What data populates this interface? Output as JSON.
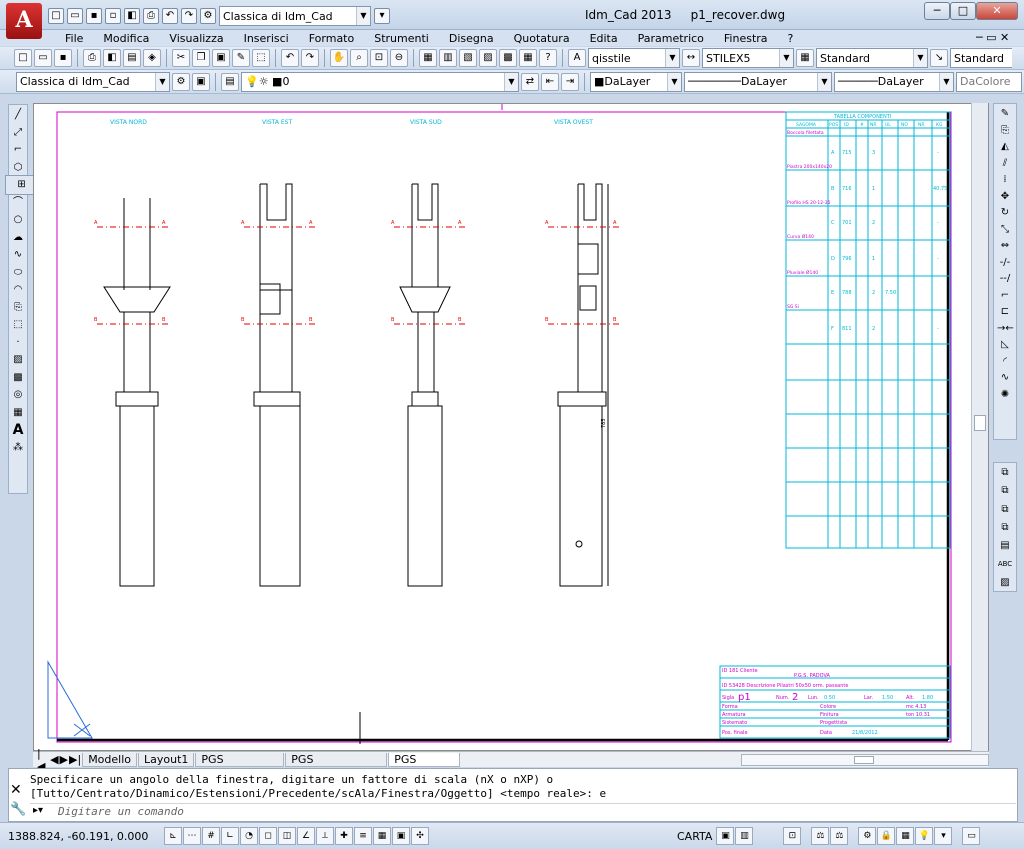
{
  "app": {
    "name": "Idm_Cad 2013",
    "file": "p1_recover.dwg",
    "logo_letter": "A"
  },
  "qat": {
    "workspace": "Classica di Idm_Cad"
  },
  "menu": [
    "File",
    "Modifica",
    "Visualizza",
    "Inserisci",
    "Formato",
    "Strumenti",
    "Disegna",
    "Quotatura",
    "Edita",
    "Parametrico",
    "Finestra",
    "?"
  ],
  "toolbar1": {
    "text_style": "qisstile",
    "dim_style": "STILEX5",
    "table_style": "Standard",
    "multileader_style": "Standard"
  },
  "toolbar2": {
    "workspace": "Classica di Idm_Cad",
    "layer": "0",
    "color": "DaLayer",
    "linetype": "DaLayer",
    "lineweight": "DaLayer",
    "plotstyle": "DaColore"
  },
  "drawing": {
    "views": [
      "VISTA NORD",
      "VISTA EST",
      "VISTA SUD",
      "VISTA OVEST"
    ],
    "section_a": "A",
    "section_b": "B",
    "dim_height": "785",
    "components_title": "TABELLA COMPONENTI",
    "table_headers": [
      "SAGOMA",
      "POS",
      "ID",
      "#",
      "NR",
      "UL",
      "NO",
      "NR",
      "KG"
    ],
    "components": [
      {
        "name": "Boccola filettata",
        "pos": "A",
        "id": "715",
        "qty": "3",
        "kg": "-"
      },
      {
        "name": "Piastra 200x140x20",
        "pos": "B",
        "id": "716",
        "qty": "1",
        "kg": "40.75"
      },
      {
        "name": "Profilo HS 20-12-35",
        "pos": "C",
        "id": "701",
        "qty": "2",
        "kg": "-"
      },
      {
        "name": "Curva Ø140",
        "pos": "D",
        "id": "796",
        "qty": "1",
        "kg": "-"
      },
      {
        "name": "Pluviale Ø140",
        "pos": "E",
        "id": "788",
        "qty": "2",
        "kg": "7.50"
      },
      {
        "name": "SG Si",
        "pos": "F",
        "id": "811",
        "qty": "2",
        "kg": "-"
      }
    ],
    "titleblock": {
      "id": "ID  181   Cliente",
      "org": "P.G.S. PADOVA",
      "desc": "ID  53428  Descrizione  Pilastri 50x50 orm. passante",
      "sigla_label": "Sigla",
      "sigla": "p1",
      "num_label": "Num.",
      "num": "2",
      "lun_label": "Lun.",
      "lun": "0.50",
      "lar_label": "Lar.",
      "lar": "1.50",
      "alt_label": "Alt.",
      "alt": "1.80",
      "forma": "Forma",
      "colore": "Colore",
      "mc": "mc  4.13",
      "armatura": "Armatura",
      "finitura": "Finitura",
      "ton": "ton  10.31",
      "sistemato": "Sistemato",
      "progettista": "Progettista",
      "firma": "Pos. finale",
      "data_label": "Data",
      "data": "21/8/2012"
    }
  },
  "tabs": [
    "Modello",
    "Layout1",
    "PGS Armatura",
    "PGS Carpenteria",
    "PGS Inserti"
  ],
  "active_tab": "PGS Inserti",
  "command": {
    "line1": "Specificare un angolo della finestra, digitare un fattore di scala (nX o nXP) o",
    "line2": "[Tutto/Centrato/Dinamico/Estensioni/Precedente/scAla/Finestra/Oggetto] <tempo reale>: e",
    "placeholder": "Digitare un comando"
  },
  "status": {
    "coords": "1388.824, -60.191, 0.000",
    "space": "CARTA"
  },
  "colors": {
    "cyan": "#00b8d8",
    "magenta": "#d000d0",
    "red": "#e00000"
  }
}
